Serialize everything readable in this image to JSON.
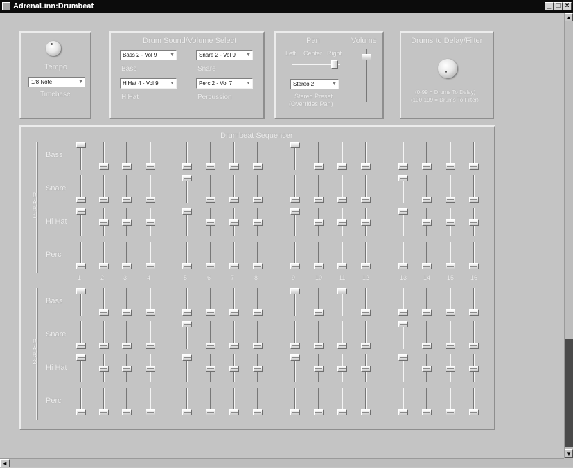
{
  "window": {
    "title": "AdrenaLinn:Drumbeat",
    "min_glyph": "_",
    "max_glyph": "□",
    "close_glyph": "×"
  },
  "scroll": {
    "up": "▲",
    "down": "▼",
    "left": "◄"
  },
  "tempo": {
    "label": "Tempo",
    "timebase_value": "1/8 Note",
    "timebase_label": "Timebase"
  },
  "drum_select": {
    "title": "Drum Sound/Volume Select",
    "bass_value": "Bass 2 - Vol 9",
    "bass_label": "Bass",
    "snare_value": "Snare 2 - Vol 9",
    "snare_label": "Snare",
    "hihat_value": "HiHat 4 - Vol 9",
    "hihat_label": "HiHat",
    "perc_value": "Perc 2 - Vol 7",
    "perc_label": "Percussion"
  },
  "pan": {
    "title": "Pan",
    "left": "Left",
    "center": "Center",
    "right": "Right",
    "stereo_value": "Stereo 2",
    "stereo_label": "Stereo Preset",
    "stereo_note": "(Overrides Pan)",
    "pan_level": 0.95
  },
  "volume": {
    "title": "Volume",
    "level": 0.9
  },
  "delay": {
    "title": "Drums to Delay/Filter",
    "note1": "(0-99 = Drums To Delay)",
    "note2": "(100-199 = Drums To Filter)"
  },
  "sequencer": {
    "title": "Drumbeat Sequencer",
    "steps": [
      "1",
      "2",
      "3",
      "4",
      "5",
      "6",
      "7",
      "8",
      "9",
      "10",
      "11",
      "12",
      "13",
      "14",
      "15",
      "16"
    ],
    "bars": [
      {
        "letters": [
          "B",
          "A",
          "R",
          "1"
        ],
        "rows": [
          {
            "label": "Bass",
            "levels": [
              1,
              0,
              0,
              0,
              0,
              0,
              0,
              0,
              1,
              0,
              0,
              0,
              0,
              0,
              0,
              0
            ]
          },
          {
            "label": "Snare",
            "levels": [
              0,
              0,
              0,
              0,
              1,
              0,
              0,
              0,
              0,
              0,
              0,
              0,
              1,
              0,
              0,
              0
            ]
          },
          {
            "label": "Hi Hat",
            "levels": [
              1,
              0.5,
              0.5,
              0.5,
              1,
              0.5,
              0.5,
              0.5,
              1,
              0.5,
              0.5,
              0.5,
              1,
              0.5,
              0.5,
              0.5
            ]
          },
          {
            "label": "Perc",
            "levels": [
              0,
              0,
              0,
              0,
              0,
              0,
              0,
              0,
              0,
              0,
              0,
              0,
              0,
              0,
              0,
              0
            ]
          }
        ]
      },
      {
        "letters": [
          "B",
          "A",
          "R",
          "2"
        ],
        "rows": [
          {
            "label": "Bass",
            "levels": [
              1,
              0,
              0,
              0,
              0,
              0,
              0,
              0,
              1,
              0,
              1,
              0,
              0,
              0,
              0,
              0
            ]
          },
          {
            "label": "Snare",
            "levels": [
              0,
              0,
              0,
              0,
              1,
              0,
              0,
              0,
              0,
              0,
              0,
              0,
              1,
              0,
              0,
              0
            ]
          },
          {
            "label": "Hi Hat",
            "levels": [
              1,
              0.5,
              0.5,
              0.5,
              1,
              0.5,
              0.5,
              0.5,
              1,
              0.5,
              0.5,
              0.5,
              1,
              0.5,
              0.5,
              0.5
            ]
          },
          {
            "label": "Perc",
            "levels": [
              0,
              0,
              0,
              0,
              0,
              0,
              0,
              0,
              0,
              0,
              0,
              0,
              0,
              0,
              0,
              0
            ]
          }
        ]
      }
    ]
  }
}
